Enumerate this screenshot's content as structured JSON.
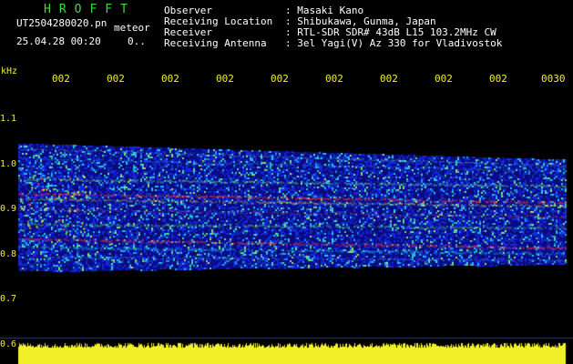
{
  "header": {
    "title": "HROFFT",
    "filename": "UT2504280020.pn",
    "mode": "meteor",
    "datetime": "25.04.28 00:20",
    "extra": "0.."
  },
  "meta": [
    {
      "label": "Observer",
      "value": ": Masaki Kano"
    },
    {
      "label": "Receiving Location",
      "value": ": Shibukawa, Gunma, Japan"
    },
    {
      "label": "Receiver",
      "value": ": RTL-SDR SDR# 43dB L15 103.2MHz CW"
    },
    {
      "label": "Receiving Antenna",
      "value": ": 3el Yagi(V) Az 330 for Vladivostok"
    }
  ],
  "axis": {
    "y_unit": "kHz",
    "y_ticks": [
      "1.1",
      "1.0",
      "0.9",
      "0.8",
      "0.7",
      "0.6"
    ],
    "x_ticks": [
      "002",
      "002",
      "002",
      "002",
      "002",
      "002",
      "002",
      "002",
      "002",
      "0030"
    ]
  },
  "colors": {
    "header_title": "#3ddc3d",
    "text": "#ffffff",
    "axis": "#f2ef2b",
    "background": "#000000",
    "spectrum_low": "#1a1ad0",
    "spectrum_mid": "#20c8c8",
    "spectrum_high": "#ff3030",
    "power_trace": "#f2ef2b"
  }
}
